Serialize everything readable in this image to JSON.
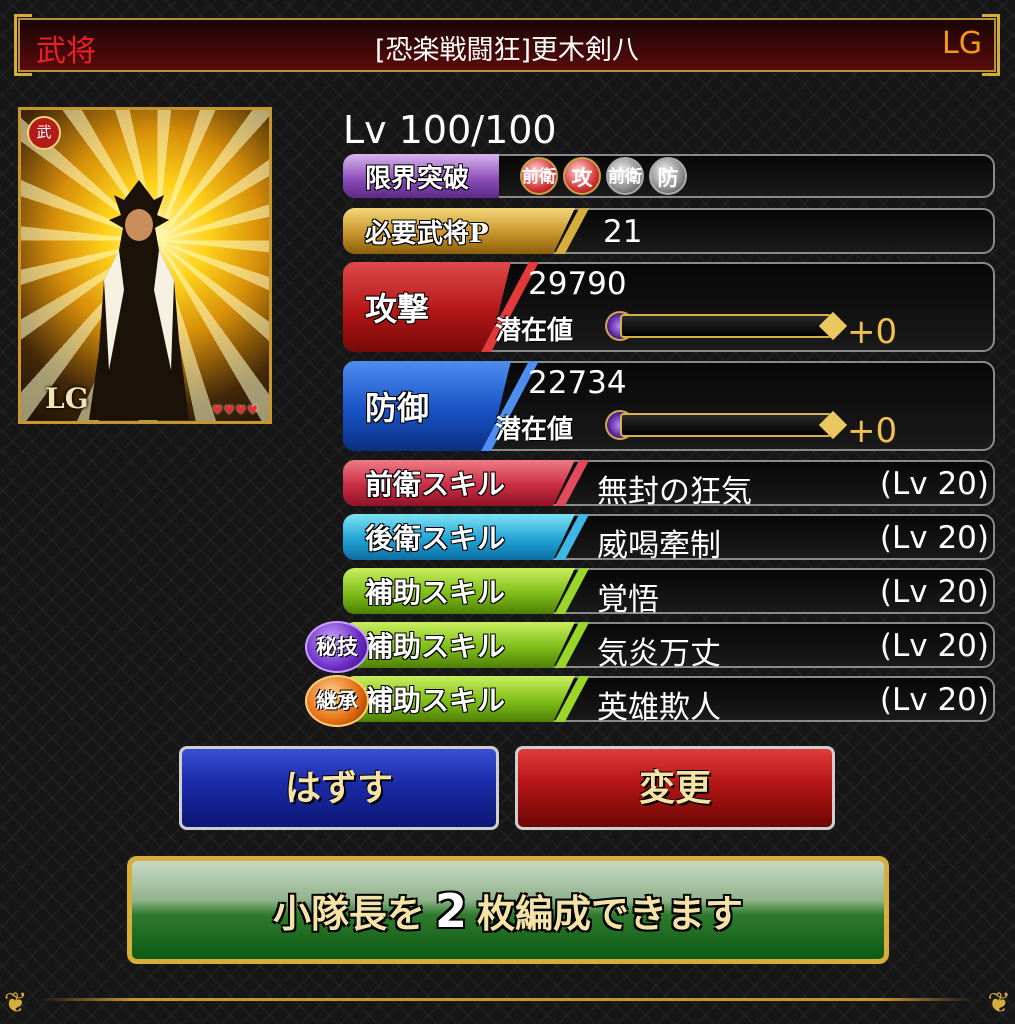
{
  "header": {
    "category": "武将",
    "title": "[恐楽戦闘狂]更木剣八",
    "rarity": "LG"
  },
  "card": {
    "rarity_label": "LG",
    "badge": "武",
    "hearts": "♥♥♥♥"
  },
  "level": "Lv 100/100",
  "limit_break": {
    "label": "限界突破",
    "medals": [
      {
        "text": "前衛",
        "active": true
      },
      {
        "text": "攻",
        "active": true
      },
      {
        "text": "前衛",
        "active": false
      },
      {
        "text": "防",
        "active": false
      }
    ]
  },
  "required_points": {
    "label": "必要武将P",
    "value": "21"
  },
  "attack": {
    "label": "攻撃",
    "value": "29790",
    "potential_label": "潜在値",
    "potential_value": "+0"
  },
  "defense": {
    "label": "防御",
    "value": "22734",
    "potential_label": "潜在値",
    "potential_value": "+0"
  },
  "skills": [
    {
      "label": "前衛スキル",
      "name": "無封の狂気",
      "level": "(Lv 20)"
    },
    {
      "label": "後衛スキル",
      "name": "威喝牽制",
      "level": "(Lv 20)"
    },
    {
      "label": "補助スキル",
      "name": "覚悟",
      "level": "(Lv 20)"
    },
    {
      "label": "補助スキル",
      "name": "気炎万丈",
      "level": "(Lv 20)",
      "badge": "秘技"
    },
    {
      "label": "補助スキル",
      "name": "英雄欺人",
      "level": "(Lv 20)",
      "badge": "継承"
    }
  ],
  "buttons": {
    "remove": "はずす",
    "change": "変更"
  },
  "banner": {
    "prefix": "小隊長を",
    "count": "2",
    "suffix": "枚編成できます"
  },
  "colors": {
    "accent_gold": "#d6ac3c",
    "attack_red": "#b31616",
    "defense_blue": "#1852c4",
    "potential_orange": "#f2c04e"
  }
}
